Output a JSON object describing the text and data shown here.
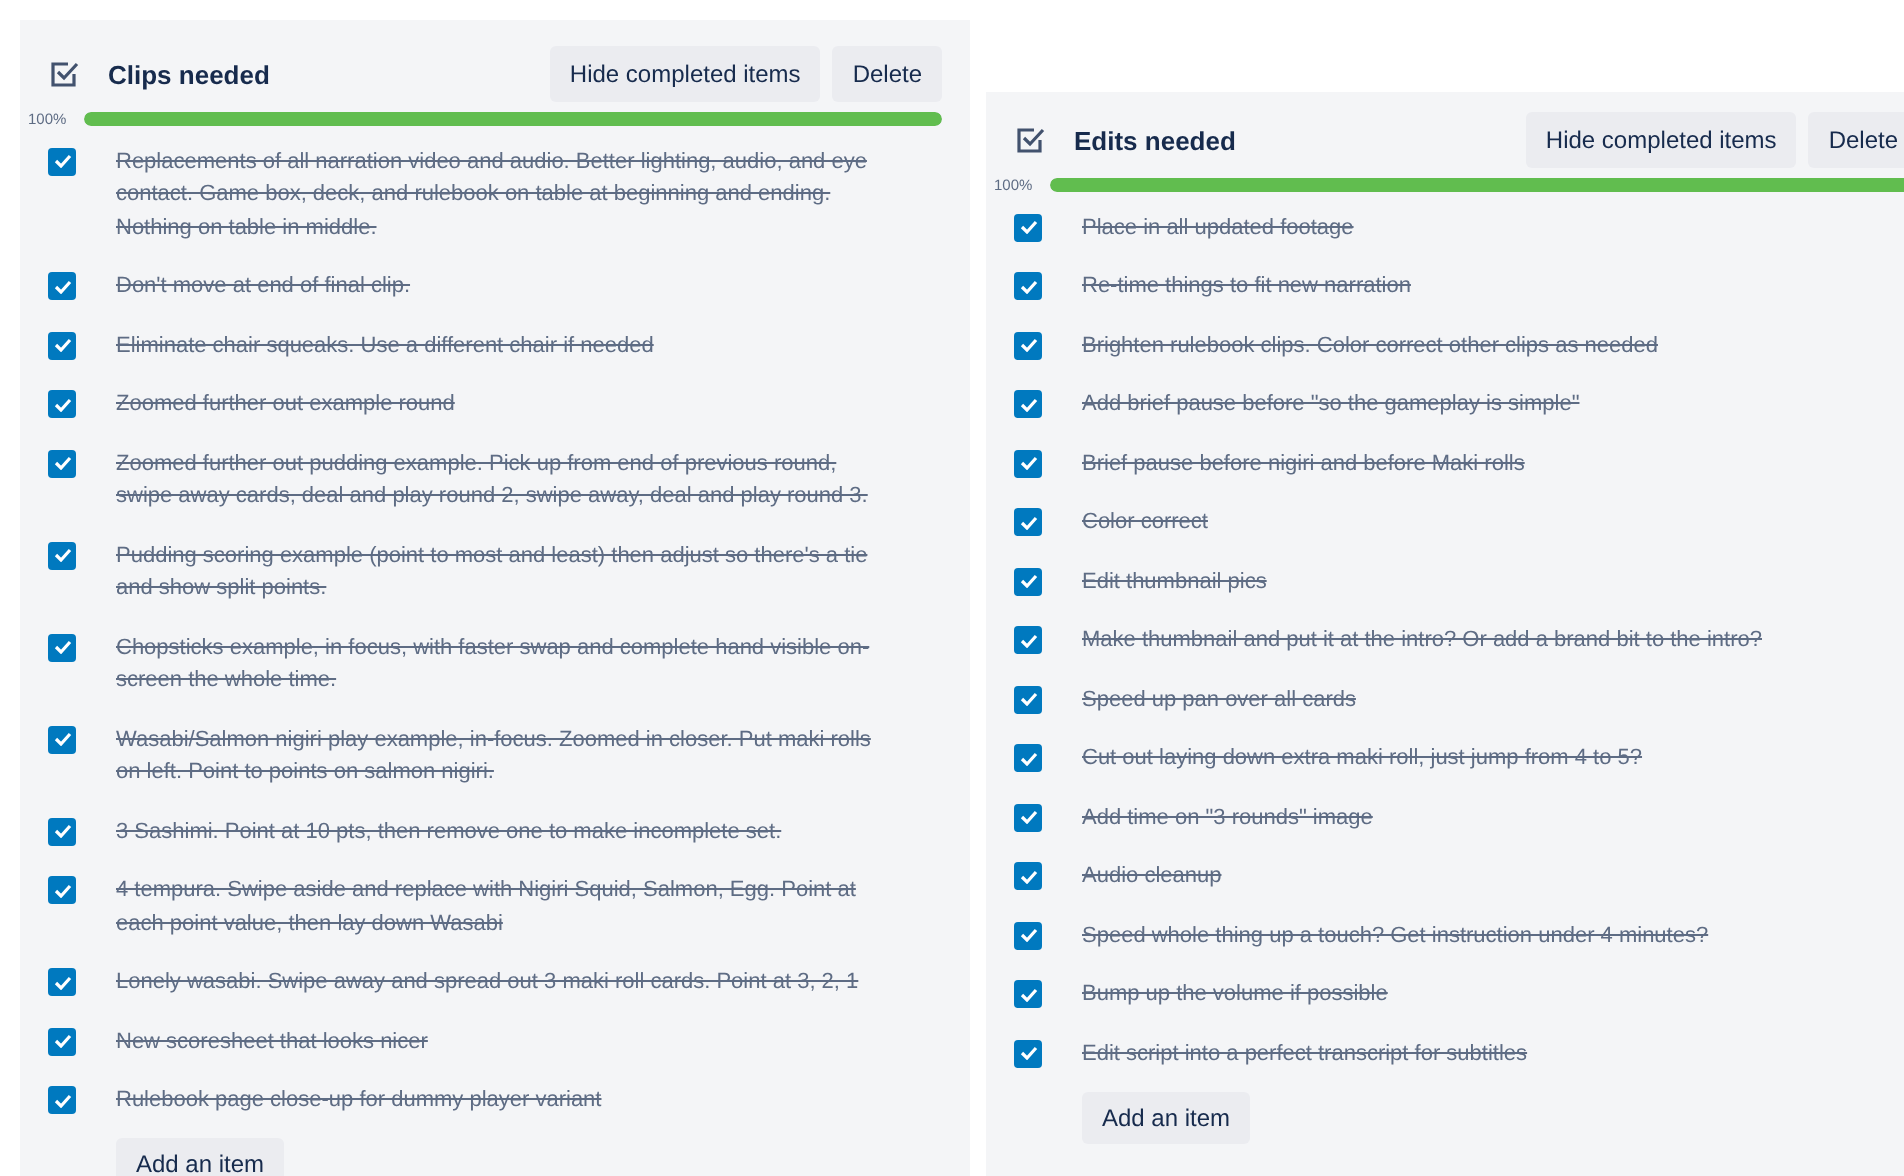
{
  "checklists": [
    {
      "title": "Clips needed",
      "buttons": [
        "Hide completed items",
        "Delete"
      ],
      "progress": {
        "label": "100%",
        "level": 1
      },
      "items": [
        {
          "text": "Replacements of all narration video and audio. Better lighting, audio, and eye contact. Game box, deck, and rulebook on table at beginning and ending. Nothing on table in middle.",
          "checked": true
        },
        {
          "text": "Don't move at end of final clip.",
          "checked": true
        },
        {
          "text": "Eliminate chair squeaks. Use a different chair if needed",
          "checked": true
        },
        {
          "text": "Zoomed further out example round",
          "checked": true
        },
        {
          "text": "Zoomed further out pudding example. Pick up from end of previous round, swipe away cards, deal and play round 2, swipe away, deal and play round 3.",
          "checked": true
        },
        {
          "text": "Pudding scoring example (point to most and least) then adjust so there's a tie and show split points.",
          "checked": true
        },
        {
          "text": "Chopsticks example, in focus, with faster swap and complete hand visible on-screen the whole time.",
          "checked": true
        },
        {
          "text": "Wasabi/Salmon nigiri play example, in-focus. Zoomed in closer. Put maki rolls on left. Point to points on salmon nigiri.",
          "checked": true
        },
        {
          "text": "3 Sashimi. Point at 10 pts, then remove one to make incomplete set.",
          "checked": true
        },
        {
          "text": "4 tempura. Swipe aside and replace with Nigiri Squid, Salmon, Egg. Point at each point value, then lay down Wasabi",
          "checked": true
        },
        {
          "text": "Lonely wasabi. Swipe away and spread out 3 maki roll cards. Point at 3, 2, 1",
          "checked": true
        },
        {
          "text": "New scoresheet that looks nicer",
          "checked": true
        },
        {
          "text": "Rulebook page close-up for dummy player variant",
          "checked": true
        }
      ],
      "add_button": "Add an item"
    },
    {
      "title": "Edits needed",
      "buttons": [
        "Hide completed items",
        "Delete"
      ],
      "progress": {
        "label": "100%",
        "level": 1
      },
      "items": [
        {
          "text": "Place in all updated footage",
          "checked": true
        },
        {
          "text": "Re-time things to fit new narration",
          "checked": true
        },
        {
          "text": "Brighten rulebook clips. Color correct other clips as needed",
          "checked": true
        },
        {
          "text": "Add brief pause before \"so the gameplay is simple\"",
          "checked": true
        },
        {
          "text": "Brief pause before nigiri and before Maki rolls",
          "checked": true
        },
        {
          "text": "Color correct",
          "checked": true
        },
        {
          "text": "Edit thumbnail pics",
          "checked": true
        },
        {
          "text": "Make thumbnail and put it at the intro? Or add a brand bit to the intro?",
          "checked": true
        },
        {
          "text": "Speed up pan over all cards",
          "checked": true
        },
        {
          "text": "Cut out laying down extra maki roll, just jump from 4 to 5?",
          "checked": true
        },
        {
          "text": "Add time on \"3 rounds\" image",
          "checked": true
        },
        {
          "text": "Audio cleanup",
          "checked": true
        },
        {
          "text": "Speed whole thing up a touch? Get instruction under 4 minutes?",
          "checked": true
        },
        {
          "text": "Bump up the volume if possible",
          "checked": true
        },
        {
          "text": "Edit script into a perfect transcript for subtitles",
          "checked": true
        }
      ],
      "add_button": "Add an item"
    }
  ]
}
